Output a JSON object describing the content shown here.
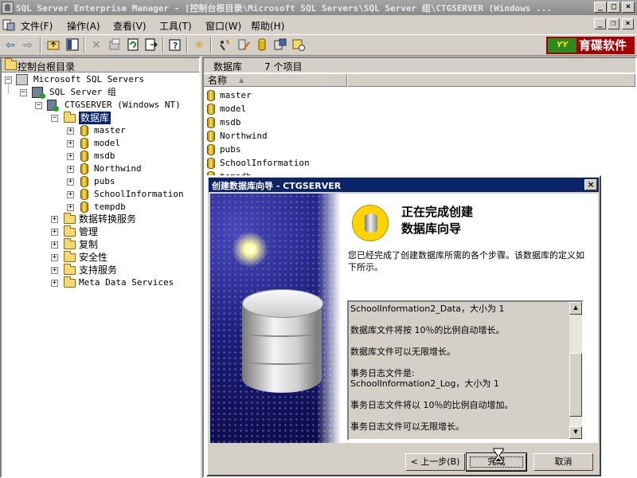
{
  "window": {
    "title": "SQL Server Enterprise Manager - [控制台根目录\\Microsoft SQL Servers\\SQL Server 组\\CTGSERVER (Windows ...",
    "minimize": "_",
    "maximize": "□",
    "close": "×"
  },
  "menu": {
    "items": [
      "文件(F)",
      "操作(A)",
      "查看(V)",
      "工具(T)",
      "窗口(W)",
      "帮助(H)"
    ],
    "mdi_minimize": "_",
    "mdi_restore": "❐",
    "mdi_close": "×"
  },
  "toolbar": {
    "icons": [
      "back-icon",
      "forward-icon",
      "up-folder-icon",
      "show-tree-icon",
      "delete-icon",
      "properties-icon",
      "refresh-icon",
      "export-icon",
      "help-icon",
      "wizard-icon",
      "new-login-icon",
      "sql-query-icon",
      "new-database-icon",
      "backup-icon",
      "server-icon"
    ],
    "logo_mark": "YY",
    "logo_text": "育碟软件"
  },
  "tree": {
    "header": "控制台根目录",
    "items": [
      {
        "label": "Microsoft SQL Servers"
      },
      {
        "label": "SQL Server 组"
      },
      {
        "label": "CTGSERVER (Windows NT)"
      },
      {
        "label": "数据库"
      },
      {
        "label": "master"
      },
      {
        "label": "model"
      },
      {
        "label": "msdb"
      },
      {
        "label": "Northwind"
      },
      {
        "label": "pubs"
      },
      {
        "label": "SchoolInformation"
      },
      {
        "label": "tempdb"
      },
      {
        "label": "数据转换服务"
      },
      {
        "label": "管理"
      },
      {
        "label": "复制"
      },
      {
        "label": "安全性"
      },
      {
        "label": "支持服务"
      },
      {
        "label": "Meta Data Services"
      }
    ]
  },
  "right_pane": {
    "title": "数据库",
    "count": "7 个项目",
    "column_name": "名称",
    "sort_indicator": "▲",
    "items": [
      "master",
      "model",
      "msdb",
      "Northwind",
      "pubs",
      "SchoolInformation",
      "tempdb"
    ]
  },
  "dialog": {
    "title": "创建数据库向导 - CTGSERVER",
    "close": "×",
    "heading_line1": "正在完成创建",
    "heading_line2": "数据库向导",
    "intro": "您已经完成了创建数据库所需的各个步骤。该数据库的定义如下所示。",
    "summary": [
      "SchoolInformation2_Data，大小为 1",
      "",
      "数据库文件将按 10％的比例自动增长。",
      "",
      "数据库文件可以无限增长。",
      "",
      "事务日志文件是:",
      "SchoolInformation2_Log，大小为 1",
      "",
      "事务日志文件将以 10％的比例自动增加。",
      "",
      "事务日志文件可以无限增长。"
    ],
    "scroll_up": "▲",
    "scroll_down": "▼",
    "back_button": "< 上一步(B)",
    "finish_button": "完成",
    "cancel_button": "取消"
  }
}
